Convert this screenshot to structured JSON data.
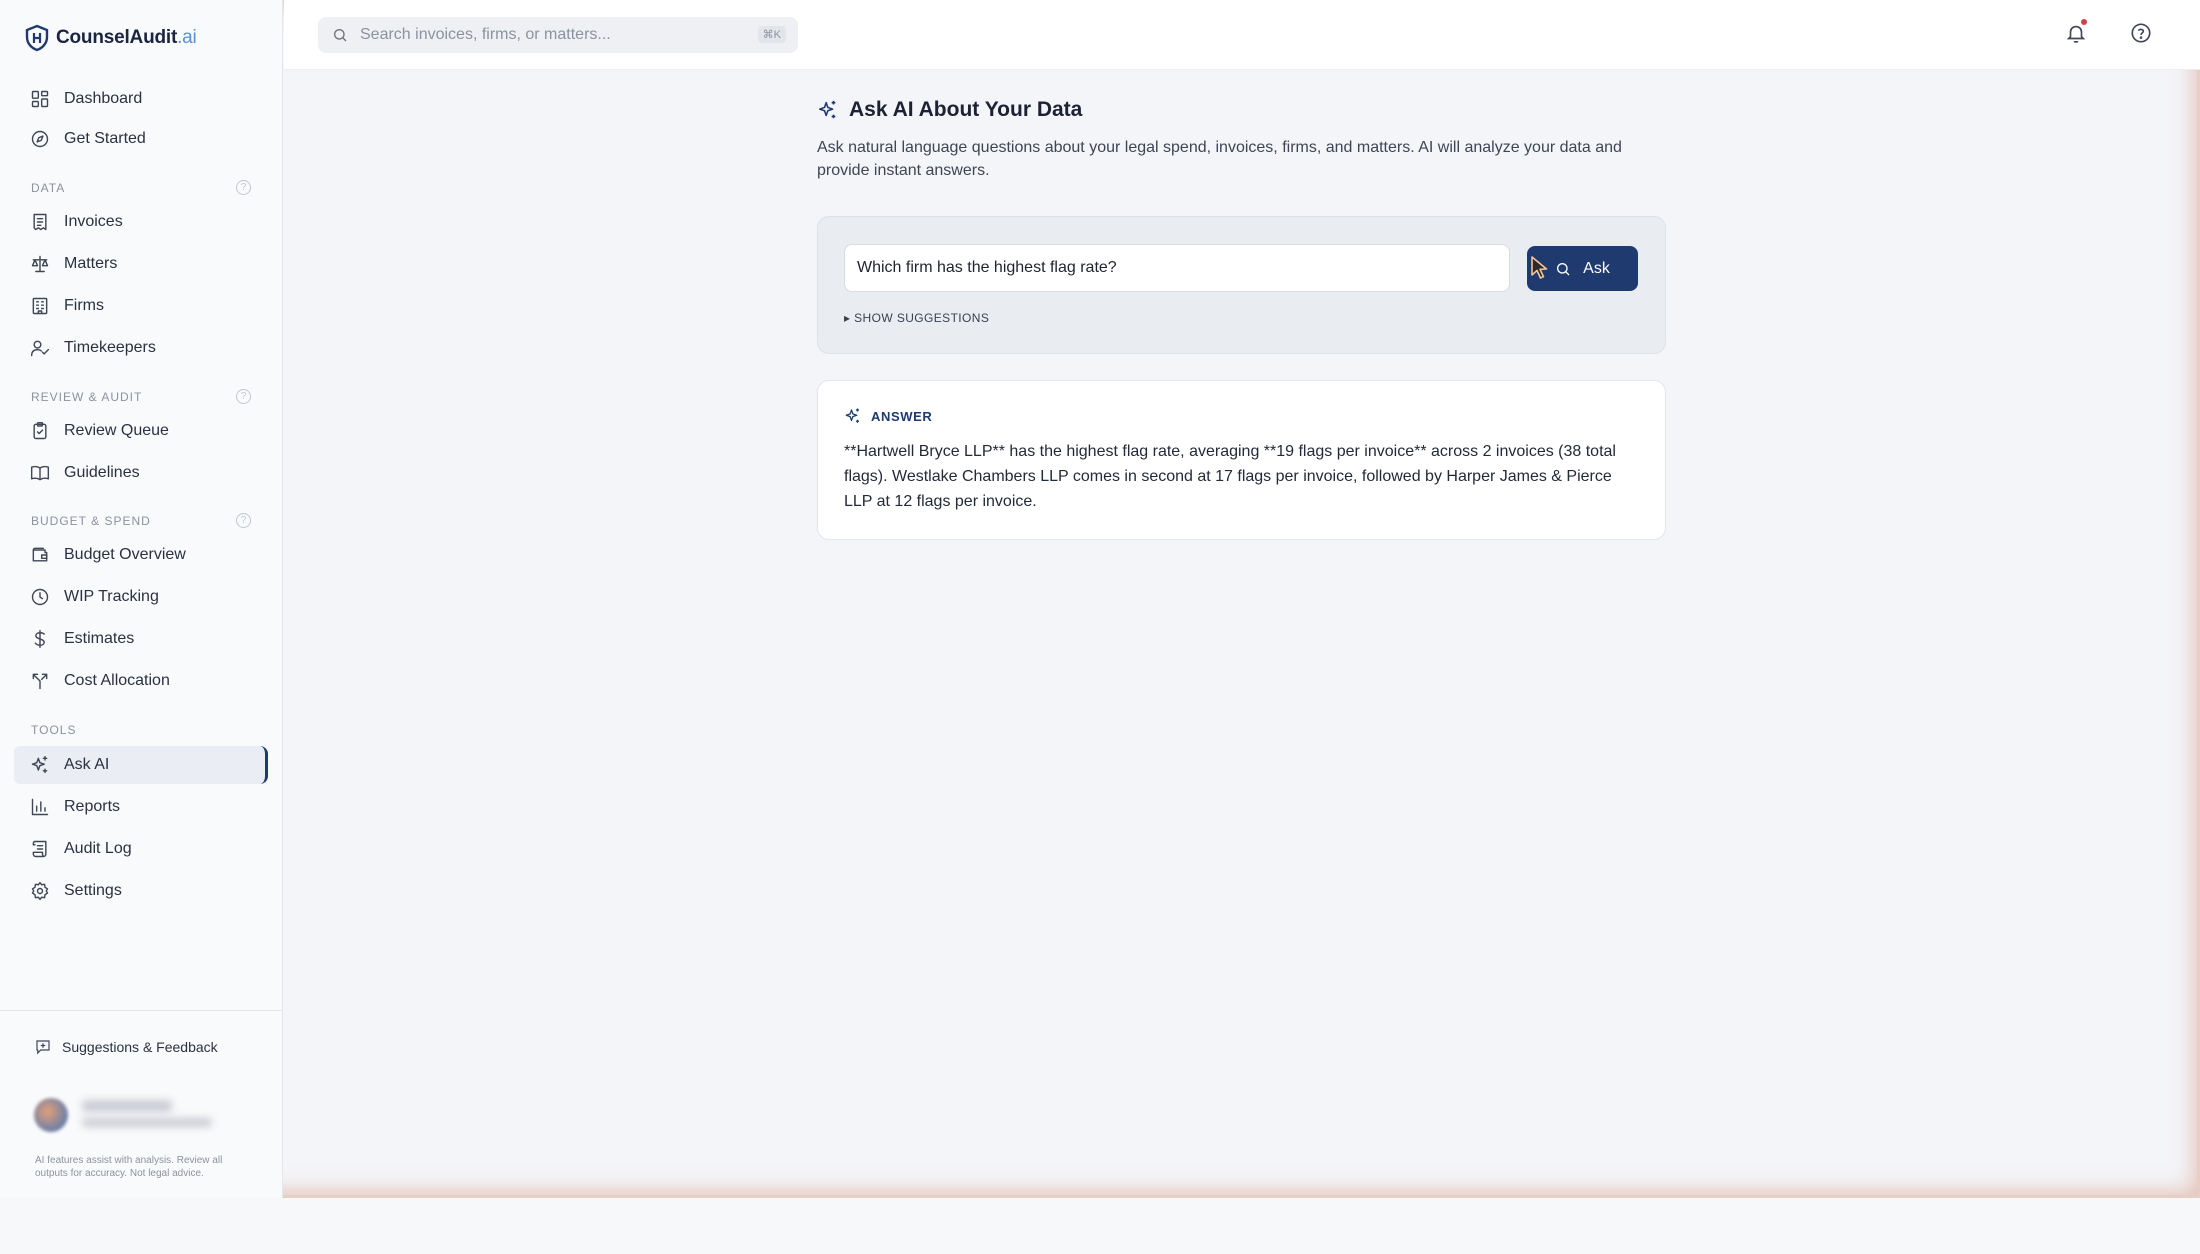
{
  "brand": {
    "name": "CounselAudit",
    "suffix": ".ai"
  },
  "colors": {
    "accent": "#1e3a6f",
    "notification_dot": "#d14343"
  },
  "search": {
    "placeholder": "Search invoices, firms, or matters...",
    "shortcut": "⌘K"
  },
  "sidebar": {
    "top_items": [
      {
        "label": "Dashboard",
        "icon": "grid-icon"
      },
      {
        "label": "Get Started",
        "icon": "compass-icon"
      }
    ],
    "sections": [
      {
        "title": "DATA",
        "items": [
          {
            "label": "Invoices",
            "icon": "receipt-icon"
          },
          {
            "label": "Matters",
            "icon": "scale-icon"
          },
          {
            "label": "Firms",
            "icon": "building-icon"
          },
          {
            "label": "Timekeepers",
            "icon": "user-clock-icon"
          }
        ]
      },
      {
        "title": "REVIEW & AUDIT",
        "items": [
          {
            "label": "Review Queue",
            "icon": "clipboard-check-icon"
          },
          {
            "label": "Guidelines",
            "icon": "book-icon"
          }
        ]
      },
      {
        "title": "BUDGET & SPEND",
        "items": [
          {
            "label": "Budget Overview",
            "icon": "wallet-icon"
          },
          {
            "label": "WIP Tracking",
            "icon": "clock-icon"
          },
          {
            "label": "Estimates",
            "icon": "dollar-icon"
          },
          {
            "label": "Cost Allocation",
            "icon": "split-icon"
          }
        ]
      },
      {
        "title": "TOOLS",
        "items": [
          {
            "label": "Ask AI",
            "icon": "sparkles-icon",
            "active": true
          },
          {
            "label": "Reports",
            "icon": "bar-chart-icon"
          },
          {
            "label": "Audit Log",
            "icon": "scroll-icon"
          },
          {
            "label": "Settings",
            "icon": "gear-icon"
          }
        ]
      }
    ],
    "feedback_label": "Suggestions & Feedback",
    "disclaimer": "AI features assist with analysis. Review all outputs for accuracy. Not legal advice."
  },
  "main": {
    "title": "Ask AI About Your Data",
    "description": "Ask natural language questions about your legal spend, invoices, firms, and matters. AI will analyze your data and provide instant answers.",
    "question_value": "Which firm has the highest flag rate?",
    "ask_label": "Ask",
    "suggestions_toggle": "▸ SHOW SUGGESTIONS",
    "answer_heading": "ANSWER",
    "answer_text": "**Hartwell Bryce LLP** has the highest flag rate, averaging **19 flags per invoice** across 2 invoices (38 total flags). Westlake Chambers LLP comes in second at 17 flags per invoice, followed by Harper James & Pierce LLP at 12 flags per invoice."
  }
}
